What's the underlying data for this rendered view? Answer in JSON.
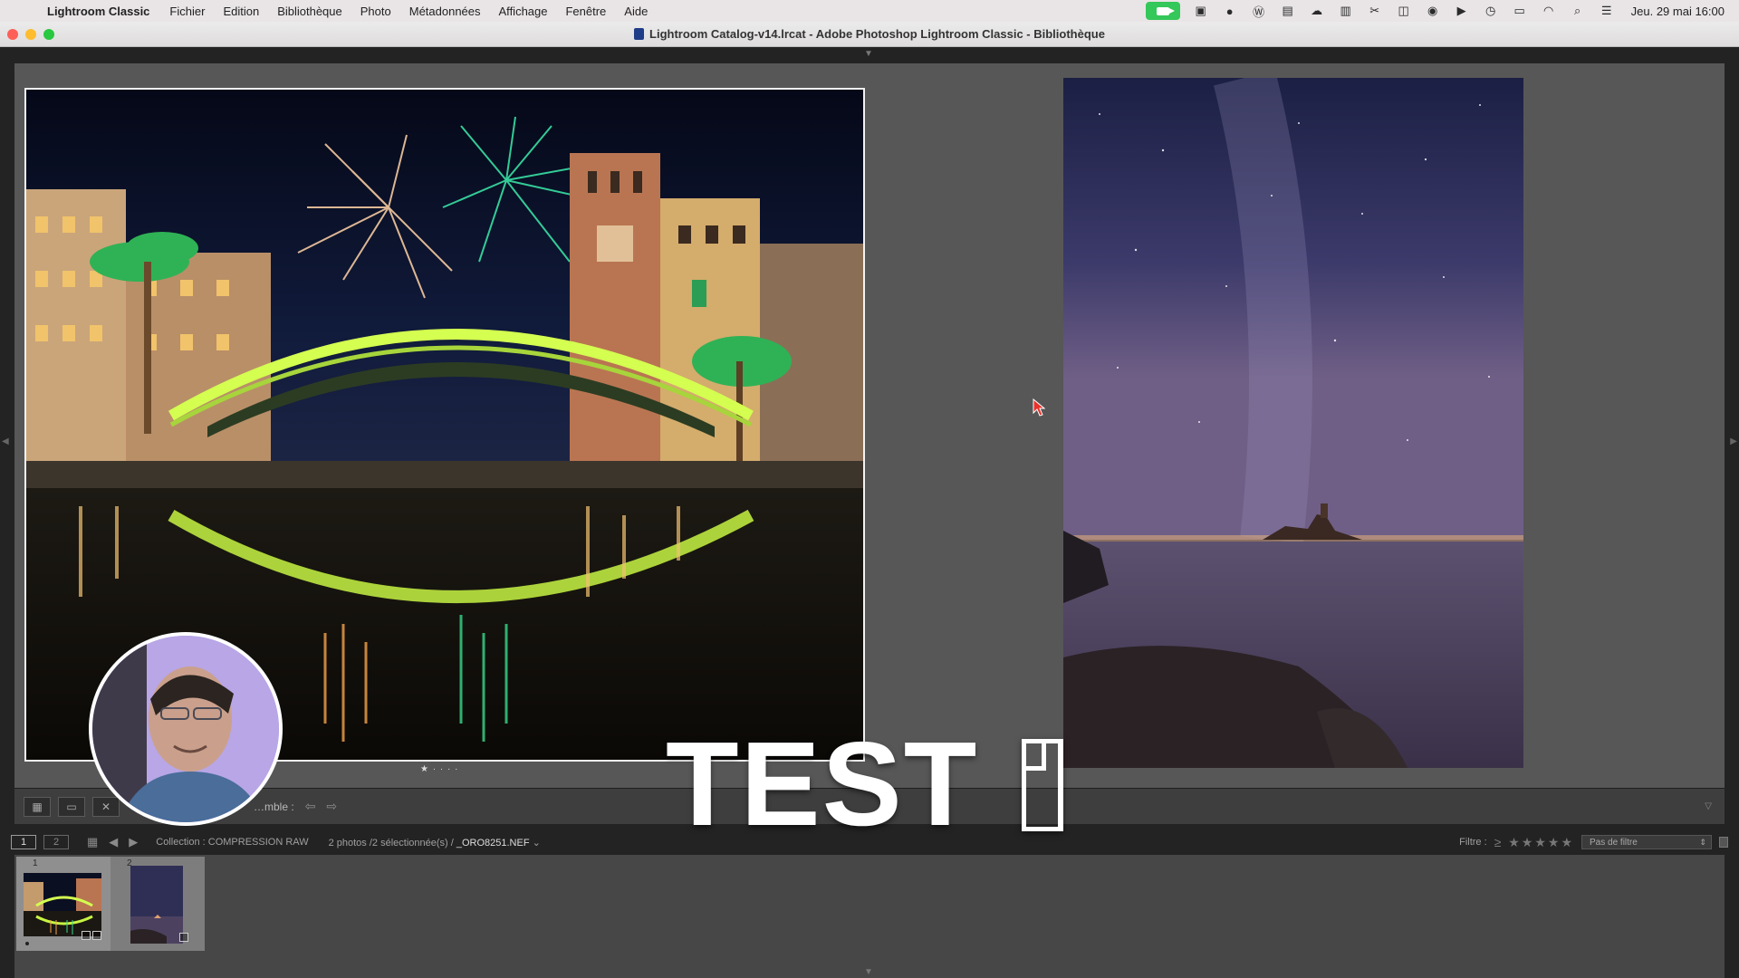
{
  "menubar": {
    "app_name": "Lightroom Classic",
    "menus": [
      "Fichier",
      "Edition",
      "Bibliothèque",
      "Photo",
      "Métadonnées",
      "Affichage",
      "Fenêtre",
      "Aide"
    ],
    "clock": "Jeu. 29 mai  16:00"
  },
  "window": {
    "title": "Lightroom Catalog-v14.lrcat - Adobe Photoshop Lightroom Classic - Bibliothèque"
  },
  "toolbar": {
    "label": "…mble :"
  },
  "filmstrip_bar": {
    "screen1": "1",
    "screen2": "2",
    "collection": "Collection : COMPRESSION RAW",
    "photo_count": "2 photos /2 sélectionnée(s) /",
    "file_name": "_ORO8251.NEF",
    "filter_label": "Filtre :",
    "filter_value": "Pas de filtre"
  },
  "filmstrip": {
    "cell1_number": "1",
    "cell2_number": "2"
  },
  "overlay": {
    "test_text": "TEST"
  },
  "colors": {
    "facetime": "#34c759",
    "panel": "#575757",
    "selected_frame": "#f2f2f2"
  }
}
